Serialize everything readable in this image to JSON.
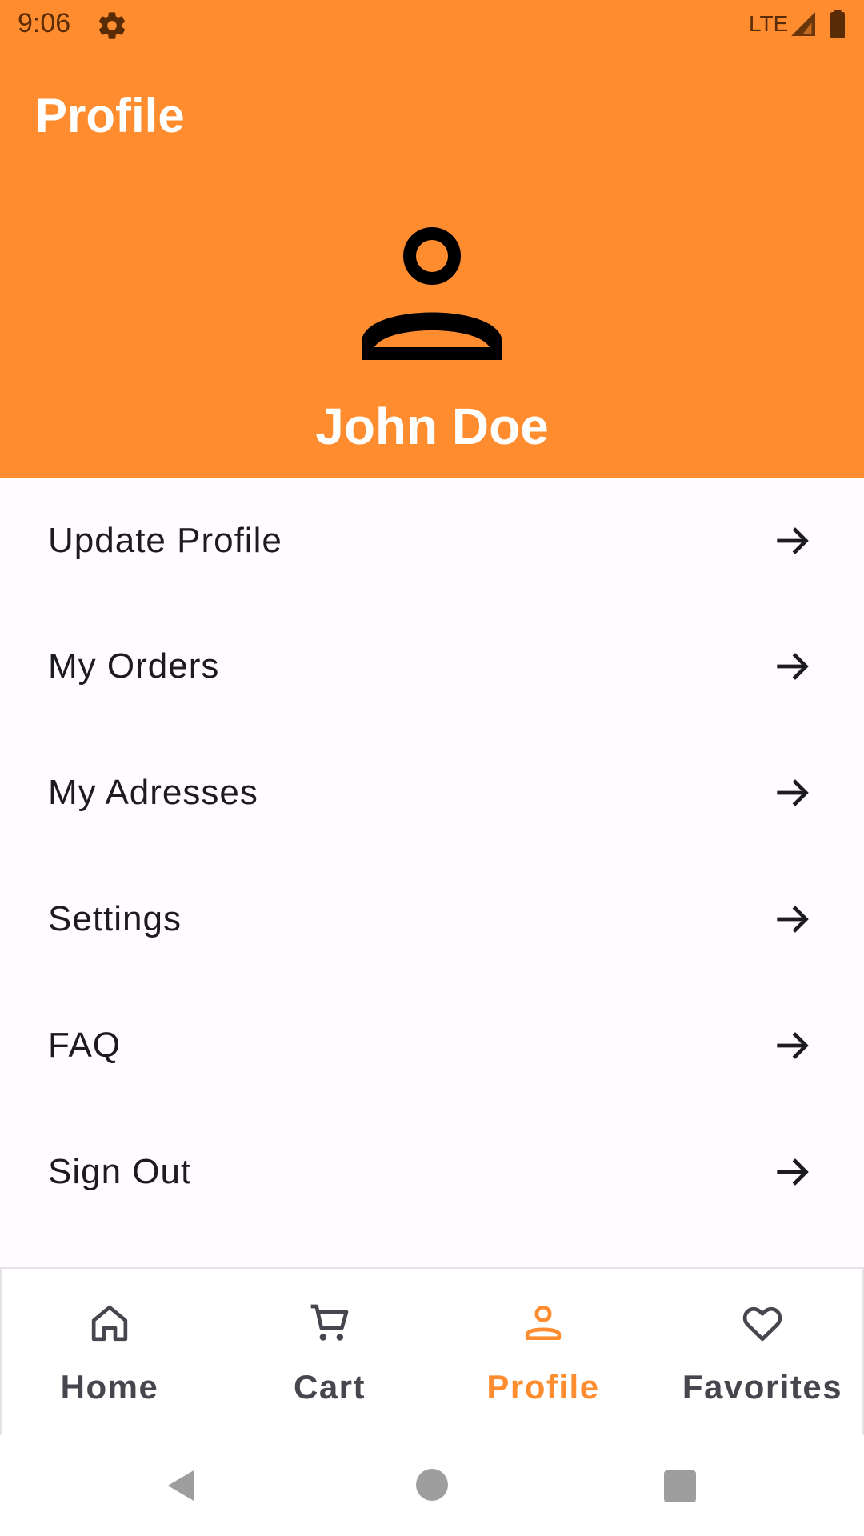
{
  "status_bar": {
    "time": "9:06",
    "network": "LTE",
    "icons": [
      "gear-icon",
      "signal-icon",
      "battery-icon"
    ]
  },
  "header": {
    "title": "Profile",
    "avatar_icon": "person-icon",
    "user_name": "John Doe",
    "background_color": "#FF8C2E"
  },
  "menu": {
    "items": [
      {
        "label": "Update Profile",
        "icon": "arrow-right-icon"
      },
      {
        "label": "My Orders",
        "icon": "arrow-right-icon"
      },
      {
        "label": "My Adresses",
        "icon": "arrow-right-icon"
      },
      {
        "label": "Settings",
        "icon": "arrow-right-icon"
      },
      {
        "label": "FAQ",
        "icon": "arrow-right-icon"
      },
      {
        "label": "Sign Out",
        "icon": "arrow-right-icon"
      }
    ]
  },
  "bottom_nav": {
    "items": [
      {
        "label": "Home",
        "icon": "home-icon",
        "active": false
      },
      {
        "label": "Cart",
        "icon": "cart-icon",
        "active": false
      },
      {
        "label": "Profile",
        "icon": "person-icon",
        "active": true
      },
      {
        "label": "Favorites",
        "icon": "heart-icon",
        "active": false
      }
    ],
    "active_color": "#FF8C2E",
    "inactive_color": "#46464f"
  },
  "system_nav": {
    "icons": [
      "back-icon",
      "home-circle-icon",
      "recents-icon"
    ]
  }
}
